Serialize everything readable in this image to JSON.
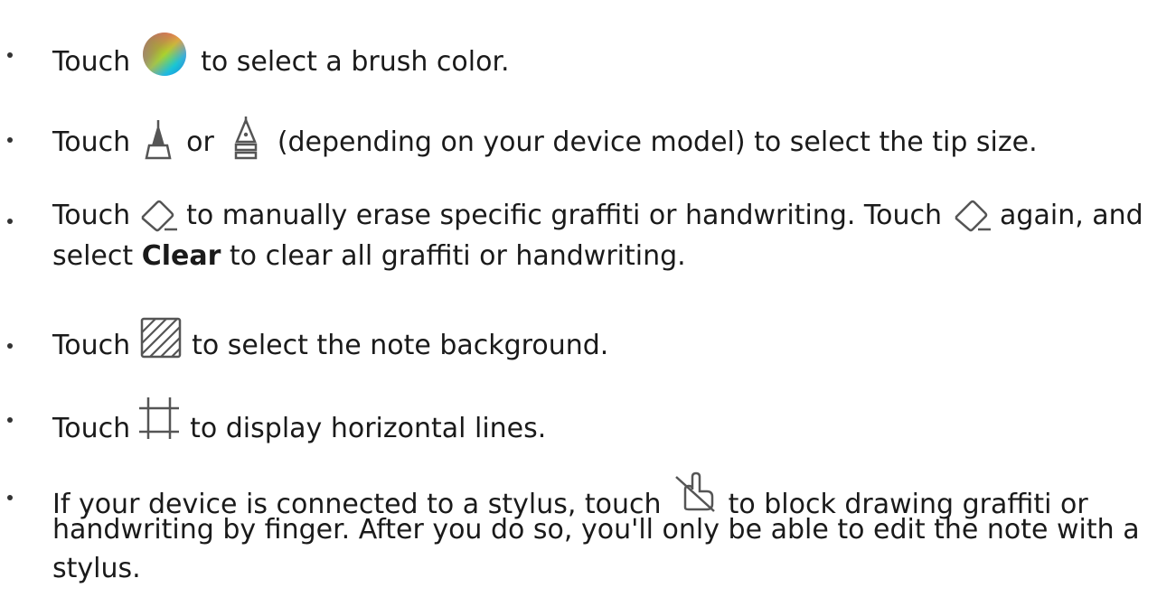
{
  "items": [
    {
      "pre": "Touch",
      "icon": "color-wheel-icon",
      "post": "to select a brush color."
    },
    {
      "pre": "Touch",
      "icon": "brush-tip-icon",
      "mid": "or",
      "icon2": "pen-tip-icon",
      "post": "(depending on your device model) to select the tip size."
    },
    {
      "pre": "Touch",
      "icon": "eraser-icon",
      "mid": "to manually erase specific graffiti or handwriting. Touch",
      "icon2": "eraser-icon",
      "post": "again, and",
      "line2_pre": "select",
      "line2_bold": "Clear",
      "line2_post": "to clear all graffiti or handwriting."
    },
    {
      "pre": "Touch",
      "icon": "background-hatch-icon",
      "post": "to select the note background."
    },
    {
      "pre": "Touch",
      "icon": "horizontal-lines-icon",
      "post": "to display horizontal lines."
    },
    {
      "pre": "If your device is connected to a stylus, touch",
      "icon": "block-finger-icon",
      "post": "to block drawing graffiti or",
      "line2": "handwriting by finger. After you do so, you'll only be able to edit the note with a",
      "line3": "stylus."
    }
  ],
  "colors": {
    "text": "#1a1a1a",
    "icon_stroke": "#555555"
  }
}
